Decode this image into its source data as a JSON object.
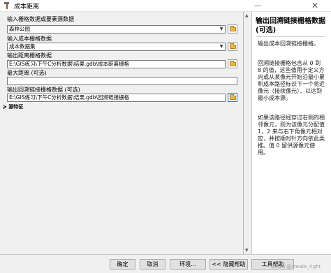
{
  "window": {
    "title": "成本距离",
    "minimize_glyph": "—",
    "close_glyph": "✕"
  },
  "params": [
    {
      "label": "输入栅格数据或要素源数据",
      "value": "森林公园",
      "type": "dropdown"
    },
    {
      "label": "输入成本栅格数据",
      "value": "成本数据集",
      "type": "dropdown"
    },
    {
      "label": "输出距离栅格数据",
      "value": "E:\\GIS练习\\下午C分析数据\\结果.gdb\\成本距离栅格",
      "type": "path"
    },
    {
      "label": "最大距离 (可选)",
      "value": "",
      "type": "text"
    },
    {
      "label": "输出回溯链接栅格数据 (可选)",
      "value": "E:\\GIS练习\\下午C分析数据\\结果.gdb\\回溯链接栅格",
      "type": "path"
    }
  ],
  "env_toggle": "≽ 源特征",
  "help": {
    "title": "输出回溯链接栅格数据 (可选)",
    "paragraphs": [
      "输出成本回溯链接栅格。",
      "回溯链接栅格包含从 0 到 8 的值，这些值用于定义方向或从某像元开始沿最小累积成本路径标识下一个将近像元（接续像元），以达到最小成本源。",
      "如果该路径经穿过右侧的相邻像元，则为该像元分配值 1，2 来与右下角像元相对应，并按顺时针方向依此类推。值 0 留供源像元使用。"
    ]
  },
  "buttons": {
    "ok": "确定",
    "cancel": "取消",
    "environments": "环境...",
    "hide_help": "<< 隐藏帮助",
    "tool_help": "工具帮助"
  },
  "scroll": {
    "up": "▲",
    "down": "▼"
  },
  "dropdown_glyph": "▼",
  "watermark": "CSDN @create_right",
  "colors": {
    "panel": "#f0f0f0",
    "field_border": "#7a7a7a",
    "folder": "#e8b84a",
    "active_border": "#3c7fb1"
  }
}
